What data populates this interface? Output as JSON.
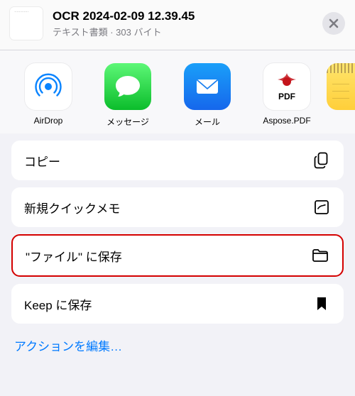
{
  "header": {
    "title": "OCR 2024-02-09 12.39.45",
    "subtitle": "テキスト書類 · 303 バイト"
  },
  "apps": [
    {
      "key": "airdrop",
      "label": "AirDrop"
    },
    {
      "key": "messages",
      "label": "メッセージ"
    },
    {
      "key": "mail",
      "label": "メール"
    },
    {
      "key": "aspose",
      "label": "Aspose.PDF",
      "pdf_tag": "PDF"
    },
    {
      "key": "notes",
      "label": ""
    }
  ],
  "actions": {
    "copy": "コピー",
    "quick_note": "新規クイックメモ",
    "save_files": "\"ファイル\" に保存",
    "keep": "Keep に保存"
  },
  "edit_actions": "アクションを編集…"
}
